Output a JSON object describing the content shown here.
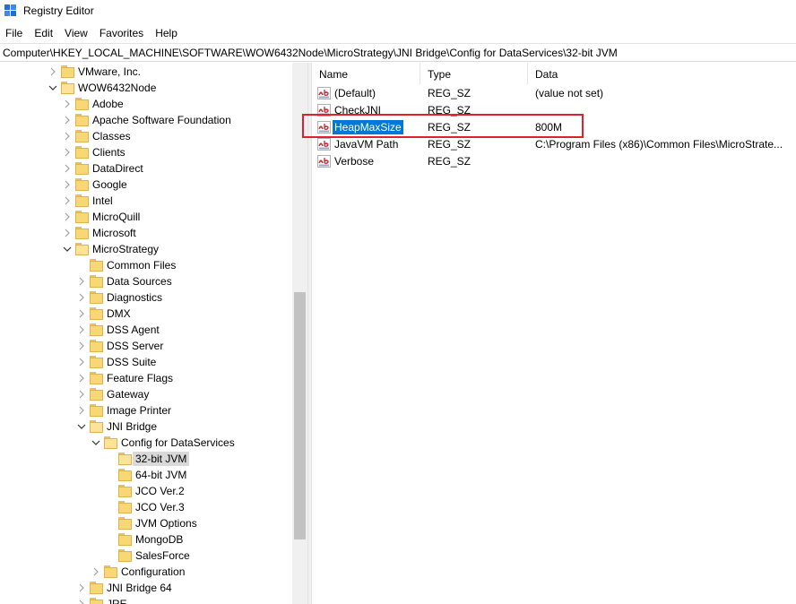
{
  "window": {
    "title": "Registry Editor"
  },
  "menu": [
    "File",
    "Edit",
    "View",
    "Favorites",
    "Help"
  ],
  "address": "Computer\\HKEY_LOCAL_MACHINE\\SOFTWARE\\WOW6432Node\\MicroStrategy\\JNI Bridge\\Config for DataServices\\32-bit JVM",
  "tree": [
    {
      "label": "VMware, Inc.",
      "expander": "collapsed"
    },
    {
      "label": "WOW6432Node",
      "expander": "expanded"
    },
    {
      "label": "Adobe",
      "expander": "collapsed"
    },
    {
      "label": "Apache Software Foundation",
      "expander": "collapsed"
    },
    {
      "label": "Classes",
      "expander": "collapsed"
    },
    {
      "label": "Clients",
      "expander": "collapsed"
    },
    {
      "label": "DataDirect",
      "expander": "collapsed"
    },
    {
      "label": "Google",
      "expander": "collapsed"
    },
    {
      "label": "Intel",
      "expander": "collapsed"
    },
    {
      "label": "MicroQuill",
      "expander": "collapsed"
    },
    {
      "label": "Microsoft",
      "expander": "collapsed"
    },
    {
      "label": "MicroStrategy",
      "expander": "expanded"
    },
    {
      "label": "Common Files",
      "expander": "none"
    },
    {
      "label": "Data Sources",
      "expander": "collapsed"
    },
    {
      "label": "Diagnostics",
      "expander": "collapsed"
    },
    {
      "label": "DMX",
      "expander": "collapsed"
    },
    {
      "label": "DSS Agent",
      "expander": "collapsed"
    },
    {
      "label": "DSS Server",
      "expander": "collapsed"
    },
    {
      "label": "DSS Suite",
      "expander": "collapsed"
    },
    {
      "label": "Feature Flags",
      "expander": "collapsed"
    },
    {
      "label": "Gateway",
      "expander": "collapsed"
    },
    {
      "label": "Image Printer",
      "expander": "collapsed"
    },
    {
      "label": "JNI Bridge",
      "expander": "expanded"
    },
    {
      "label": "Config for DataServices",
      "expander": "expanded"
    },
    {
      "label": "32-bit JVM",
      "expander": "none",
      "selected": true
    },
    {
      "label": "64-bit JVM",
      "expander": "none"
    },
    {
      "label": "JCO Ver.2",
      "expander": "none"
    },
    {
      "label": "JCO Ver.3",
      "expander": "none"
    },
    {
      "label": "JVM Options",
      "expander": "none"
    },
    {
      "label": "MongoDB",
      "expander": "none"
    },
    {
      "label": "SalesForce",
      "expander": "none"
    },
    {
      "label": "Configuration",
      "expander": "collapsed"
    },
    {
      "label": "JNI Bridge 64",
      "expander": "collapsed"
    },
    {
      "label": "JRE",
      "expander": "collapsed"
    }
  ],
  "columns": [
    "Name",
    "Type",
    "Data"
  ],
  "values": [
    {
      "name": "(Default)",
      "type": "REG_SZ",
      "data": "(value not set)",
      "icon": "string-value-icon"
    },
    {
      "name": "CheckJNI",
      "type": "REG_SZ",
      "data": "",
      "icon": "string-value-icon"
    },
    {
      "name": "HeapMaxSize",
      "type": "REG_SZ",
      "data": "800M",
      "icon": "string-value-icon",
      "selected": true
    },
    {
      "name": "JavaVM Path",
      "type": "REG_SZ",
      "data": "C:\\Program Files (x86)\\Common Files\\MicroStrate...",
      "icon": "string-value-icon"
    },
    {
      "name": "Verbose",
      "type": "REG_SZ",
      "data": "",
      "icon": "string-value-icon"
    }
  ],
  "colors": {
    "selection": "#0078d7",
    "highlight_box": "#e0202a",
    "folder": "#f8d775"
  }
}
